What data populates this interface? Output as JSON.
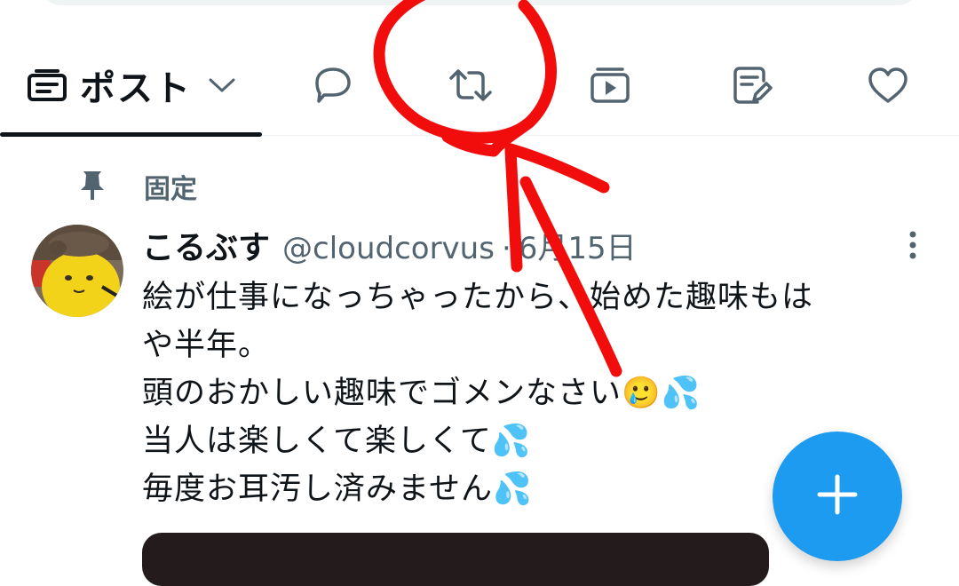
{
  "tabs": {
    "posts_label": "ポスト",
    "items": [
      {
        "icon": "reply-icon"
      },
      {
        "icon": "repost-icon"
      },
      {
        "icon": "video-icon"
      },
      {
        "icon": "article-icon"
      },
      {
        "icon": "heart-icon"
      }
    ]
  },
  "pinned": {
    "label": "固定"
  },
  "post": {
    "display_name": "こるぶす",
    "handle": "@cloudcorvus",
    "separator": "·",
    "date": "6月15日",
    "lines": [
      "絵が仕事になっちゃったから、始めた趣味もは",
      "や半年。",
      "頭のおかしい趣味でゴメンなさい🥲💦",
      "当人は楽しくて楽しくて💦",
      "毎度お耳汚し済みません💦"
    ]
  },
  "colors": {
    "accent": "#1d9bf0",
    "secondary_text": "#536471",
    "annotation": "#f20d0d"
  }
}
